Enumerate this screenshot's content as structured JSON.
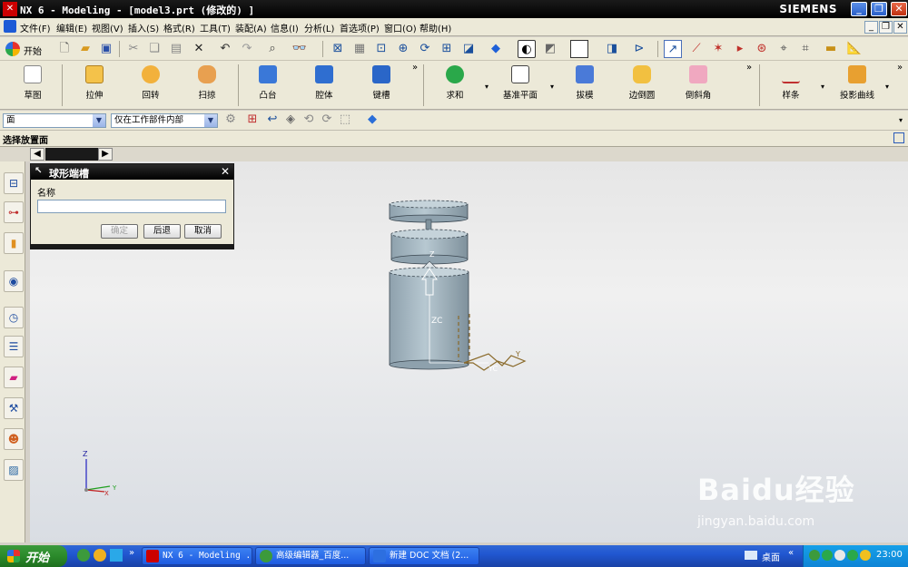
{
  "window": {
    "title": "NX 6 - Modeling - [model3.prt (修改的) ]",
    "brand": "SIEMENS",
    "logo": "NX",
    "controls": [
      "_",
      "❐",
      "✕"
    ]
  },
  "menu": {
    "items": [
      "文件(F)",
      "编辑(E)",
      "视图(V)",
      "插入(S)",
      "格式(R)",
      "工具(T)",
      "装配(A)",
      "信息(I)",
      "分析(L)",
      "首选项(P)",
      "窗口(O)",
      "帮助(H)"
    ],
    "mdi_controls": [
      "_",
      "❐",
      "✕"
    ]
  },
  "standard_toolbar": {
    "start_label": "开始"
  },
  "feature_toolbar": {
    "sketch": "草图",
    "extrude": "拉伸",
    "revolve": "回转",
    "sweep": "扫掠",
    "boss": "凸台",
    "pocket": "腔体",
    "slot": "键槽",
    "unite": "求和",
    "datum_plane": "基准平面",
    "draft": "拔模",
    "edge_blend": "边倒圆",
    "chamfer": "倒斜角",
    "spline": "样条",
    "project_curve": "投影曲线",
    "overflow": "»"
  },
  "selection_bar": {
    "filter_value": "面",
    "scope_value": "仅在工作部件内部"
  },
  "prompt": {
    "text": "选择放置面"
  },
  "dialog": {
    "title": "球形端槽",
    "name_label": "名称",
    "name_value": "",
    "ok": "确定",
    "back": "后退",
    "cancel": "取消"
  },
  "viewport": {
    "axis_labels": {
      "z": "Z",
      "zc": "ZC",
      "y": "Y",
      "yc": "YC"
    },
    "triad_labels": {
      "z": "Z",
      "x": "X",
      "y": "Y"
    }
  },
  "taskbar": {
    "start": "开始",
    "tasks": [
      "NX 6 - Modeling ...",
      "高级编辑器_百度...",
      "新建 DOC 文档 (2..."
    ],
    "desktop_label": "桌面",
    "clock": "23:00"
  },
  "watermark": {
    "logo": "Baidu经验",
    "url": "jingyan.baidu.com"
  },
  "colors": {
    "model_body": "#a9bcc6",
    "titlebar": "#000000",
    "taskbar": "#2157d1"
  }
}
